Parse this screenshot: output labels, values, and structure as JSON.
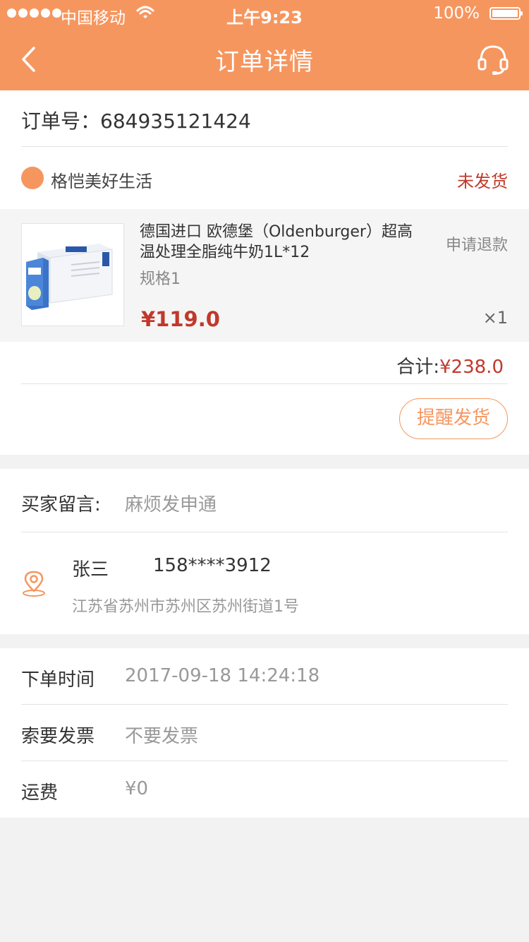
{
  "status_bar": {
    "carrier": "中国移动",
    "time": "上午9:23",
    "battery": "100%"
  },
  "nav": {
    "title": "订单详情"
  },
  "order": {
    "number_text": "订单号：684935121424",
    "shop_name": "格恺美好生活",
    "status": "未发货"
  },
  "product": {
    "title": "德国进口 欧德堡（Oldenburger）超高温处理全脂纯牛奶1L*12",
    "spec": "规格1",
    "price": "¥119.0",
    "refund_label": "申请退款",
    "quantity": "×1"
  },
  "total": {
    "label": "合计:",
    "amount": "¥238.0"
  },
  "actions": {
    "remind_label": "提醒发货"
  },
  "buyer": {
    "message_label": "买家留言:",
    "message_value": "麻烦发申通"
  },
  "receiver": {
    "name": "张三",
    "phone": "158****3912",
    "address": "江苏省苏州市苏州区苏州街道1号"
  },
  "info": {
    "order_time_label": "下单时间",
    "order_time_value": "2017-09-18 14:24:18",
    "invoice_label": "索要发票",
    "invoice_value": "不要发票",
    "shipping_label": "运费",
    "shipping_value": "¥0"
  },
  "colors": {
    "accent": "#f6965f",
    "price_red": "#c0392b"
  }
}
